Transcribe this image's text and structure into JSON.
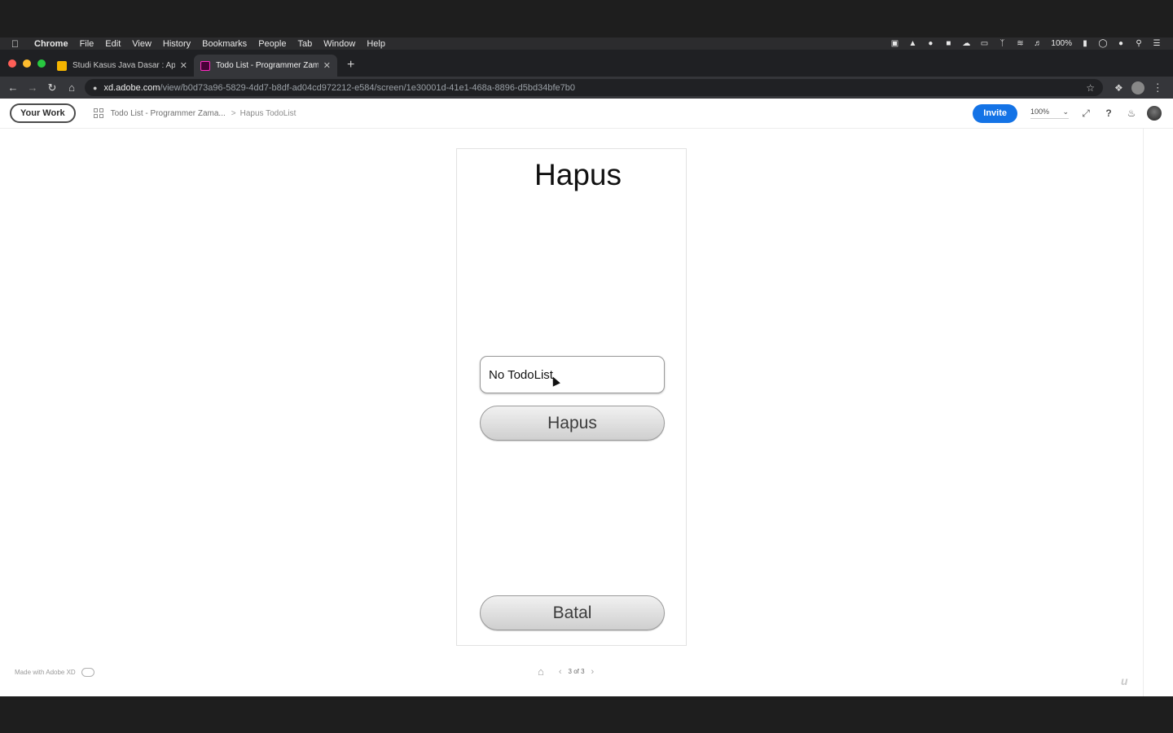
{
  "menubar": {
    "apple_icon": "apple-icon",
    "items": [
      "Chrome",
      "File",
      "Edit",
      "View",
      "History",
      "Bookmarks",
      "People",
      "Tab",
      "Window",
      "Help"
    ],
    "battery": "100%"
  },
  "tabs": [
    {
      "title": "Studi Kasus Java Dasar : Aplik",
      "favicon_color": "#f4b400"
    },
    {
      "title": "Todo List - Programmer Zaman",
      "favicon_color": "#ff2bc2"
    }
  ],
  "address": {
    "host": "xd.adobe.com",
    "path": "/view/b0d73a96-5829-4dd7-b8df-ad04cd972212-e584/screen/1e30001d-41e1-468a-8896-d5bd34bfe7b0"
  },
  "xd_header": {
    "your_work": "Your Work",
    "breadcrumb_project": "Todo List - Programmer Zama...",
    "breadcrumb_sep": ">",
    "breadcrumb_screen": "Hapus TodoList",
    "invite": "Invite",
    "zoom": "100%"
  },
  "artboard": {
    "title": "Hapus",
    "input_value": "No TodoList",
    "hapus_button": "Hapus",
    "batal_button": "Batal"
  },
  "footer": {
    "made_with": "Made with Adobe XD",
    "pager": "3 of 3"
  },
  "colors": {
    "invite": "#1473e6",
    "traffic_red": "#ff5f57",
    "traffic_yellow": "#febc2e",
    "traffic_green": "#28c840"
  }
}
